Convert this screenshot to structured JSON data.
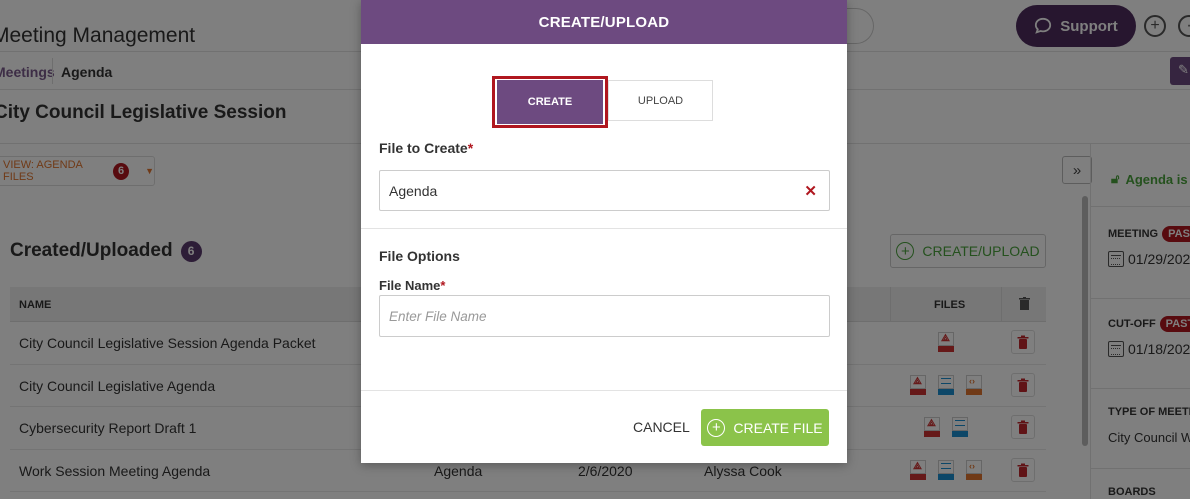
{
  "app": {
    "title": "Meeting Management",
    "support_label": "Support",
    "breadcrumb": [
      "Meetings",
      "Agenda"
    ],
    "page_title": "City Council Legislative Session",
    "view_button": {
      "label": "VIEW: AGENDA FILES",
      "count": "6"
    },
    "section": {
      "title": "Created/Uploaded",
      "count": "6"
    },
    "create_upload_label": "CREATE/UPLOAD",
    "table": {
      "headers": {
        "name": "NAME",
        "files": "FILES"
      },
      "rows": [
        {
          "name": "City Council Legislative Session Agenda Packet",
          "type": "",
          "date": "",
          "author": "",
          "files": [
            "pdf"
          ]
        },
        {
          "name": "City Council Legislative Agenda",
          "type": "",
          "date": "",
          "author": "",
          "files": [
            "pdf",
            "doc",
            "htm"
          ]
        },
        {
          "name": "Cybersecurity Report Draft 1",
          "type": "",
          "date": "",
          "author": "",
          "files": [
            "pdf",
            "doc"
          ]
        },
        {
          "name": "Work Session Meeting Agenda",
          "type": "Agenda",
          "date": "2/6/2020",
          "author": "Alyssa Cook",
          "files": [
            "pdf",
            "doc",
            "htm"
          ]
        }
      ]
    },
    "right_panel": {
      "status": "Agenda is U",
      "meeting_label": "MEETING",
      "meeting_date": "01/29/202",
      "cutoff_label": "CUT-OFF",
      "cutoff_date": "01/18/202",
      "past_badge": "PAST",
      "type_label": "TYPE OF MEETIN",
      "type_value": "City Council W",
      "boards_label": "BOARDS"
    }
  },
  "modal": {
    "title": "CREATE/UPLOAD",
    "tabs": {
      "create": "CREATE",
      "upload": "UPLOAD",
      "active": "create"
    },
    "file_to_create": {
      "label": "File to Create",
      "required_mark": "*",
      "value": "Agenda"
    },
    "file_options_heading": "File Options",
    "file_name": {
      "label": "File Name",
      "required_mark": "*",
      "value": "",
      "placeholder": "Enter File Name"
    },
    "cancel_label": "CANCEL",
    "create_file_label": "CREATE FILE"
  },
  "colors": {
    "brand_purple": "#6d4a80",
    "alert_red": "#b0171f",
    "success_green": "#8bc34a",
    "accent_orange": "#e0752e"
  }
}
